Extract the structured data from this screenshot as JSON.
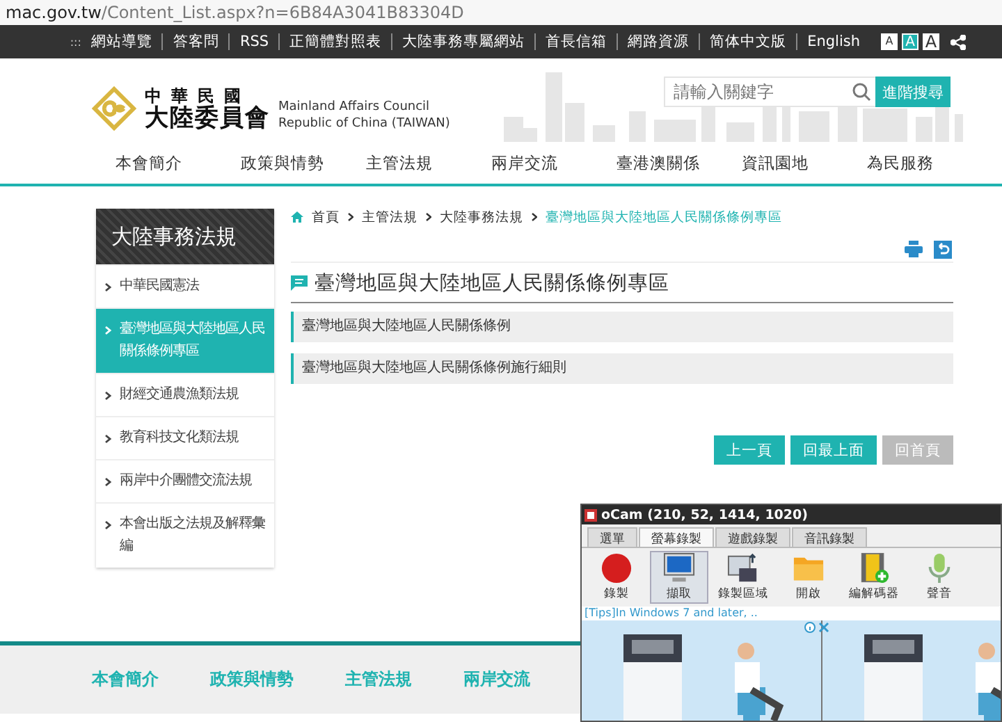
{
  "address_bar": {
    "host": "mac.gov.tw",
    "path": "/Content_List.aspx?n=6B84A3041B83304D"
  },
  "top_bar": {
    "accesskey": ":::",
    "links": [
      "網站導覽",
      "答客問",
      "RSS",
      "正簡體對照表",
      "大陸事務專屬網站",
      "首長信箱",
      "網路資源",
      "简体中文版",
      "English"
    ],
    "font_sizes": [
      {
        "label": "A",
        "selected": false
      },
      {
        "label": "A",
        "selected": true
      },
      {
        "label": "A",
        "selected": false
      }
    ]
  },
  "header": {
    "logo": {
      "line_1": "中華民國",
      "line_2": "大陸委員會",
      "english_1": "Mainland Affairs Council",
      "english_2": "Republic of China (TAIWAN)"
    },
    "search": {
      "placeholder": "請輸入關鍵字",
      "button": "進階搜尋"
    }
  },
  "nav": [
    "本會簡介",
    "政策與情勢",
    "主管法規",
    "兩岸交流",
    "臺港澳關係",
    "資訊園地",
    "為民服務"
  ],
  "sidebar": {
    "title": "大陸事務法規",
    "items": [
      {
        "label": "中華民國憲法",
        "selected": false
      },
      {
        "label": "臺灣地區與大陸地區人民關係條例專區",
        "selected": true
      },
      {
        "label": "財經交通農漁類法規",
        "selected": false
      },
      {
        "label": "教育科技文化類法規",
        "selected": false
      },
      {
        "label": "兩岸中介團體交流法規",
        "selected": false
      },
      {
        "label": "本會出版之法規及解釋彙編",
        "selected": false
      }
    ]
  },
  "breadcrumb": [
    {
      "label": "首頁",
      "current": false
    },
    {
      "label": "主管法規",
      "current": false
    },
    {
      "label": "大陸事務法規",
      "current": false
    },
    {
      "label": "臺灣地區與大陸地區人民關係條例專區",
      "current": true
    }
  ],
  "heading": "臺灣地區與大陸地區人民關係條例專區",
  "list": [
    "臺灣地區與大陸地區人民關係條例",
    "臺灣地區與大陸地區人民關係條例施行細則"
  ],
  "pager": [
    {
      "label": "上一頁",
      "disabled": false
    },
    {
      "label": "回最上面",
      "disabled": false
    },
    {
      "label": "回首頁",
      "disabled": true
    }
  ],
  "footer_nav": [
    "本會簡介",
    "政策與情勢",
    "主管法規",
    "兩岸交流"
  ],
  "ocam": {
    "title": "oCam (210, 52, 1414, 1020)",
    "tabs": [
      {
        "label": "選單",
        "selected": false
      },
      {
        "label": "螢幕錄製",
        "selected": true
      },
      {
        "label": "遊戲錄製",
        "selected": false
      },
      {
        "label": "音訊錄製",
        "selected": false
      }
    ],
    "tools": [
      {
        "label": "錄製",
        "kind": "record",
        "selected": false
      },
      {
        "label": "擷取",
        "kind": "capture",
        "selected": true
      },
      {
        "label": "錄製區域",
        "kind": "area",
        "selected": false
      },
      {
        "label": "開啟",
        "kind": "open",
        "selected": false
      },
      {
        "label": "編解碼器",
        "kind": "codec",
        "selected": false
      },
      {
        "label": "聲音",
        "kind": "sound",
        "selected": false
      }
    ],
    "tips": "[Tips]In Windows 7 and later, .."
  }
}
